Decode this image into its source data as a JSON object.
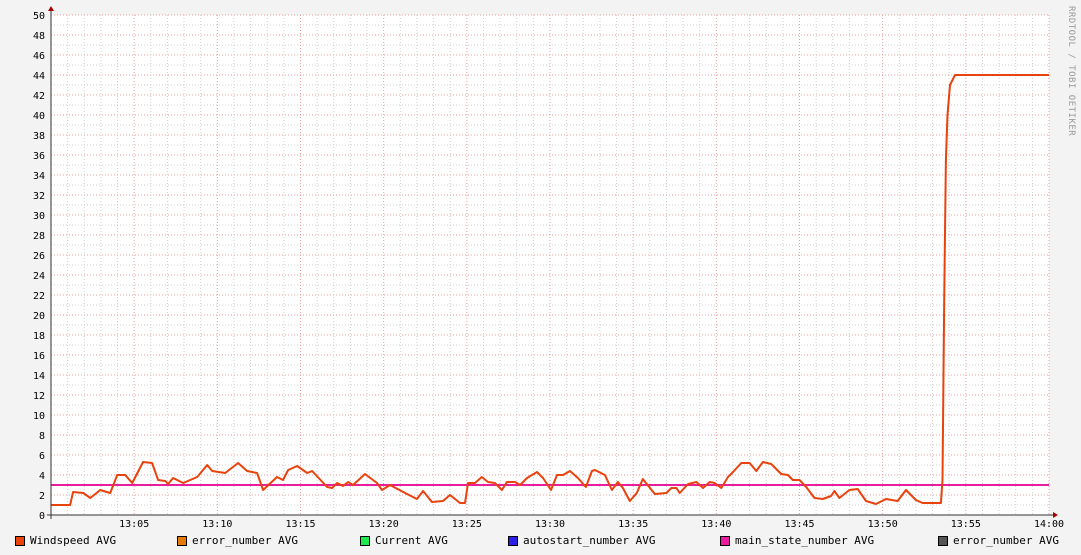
{
  "watermark": "RRDTOOL / TOBI OETIKER",
  "chart_data": {
    "type": "line",
    "title": "",
    "xlabel": "",
    "ylabel": "",
    "ylim": [
      0,
      50
    ],
    "xlim_minutes": [
      0,
      60
    ],
    "start_time": "13:00",
    "y_ticks": [
      "0",
      "2",
      "4",
      "6",
      "8",
      "10",
      "12",
      "14",
      "16",
      "18",
      "20",
      "22",
      "24",
      "26",
      "28",
      "30",
      "32",
      "34",
      "36",
      "38",
      "40",
      "42",
      "44",
      "46",
      "48",
      "50"
    ],
    "x_ticks": [
      "13:05",
      "13:10",
      "13:15",
      "13:20",
      "13:25",
      "13:30",
      "13:35",
      "13:40",
      "13:45",
      "13:50",
      "13:55",
      "14:00"
    ],
    "grid": true,
    "legend_position": "bottom",
    "legend": [
      {
        "label": "Windspeed AVG",
        "color": "#e8420d"
      },
      {
        "label": "error_number AVG",
        "color": "#e87a0d"
      },
      {
        "label": "Current AVG",
        "color": "#1ee84a"
      },
      {
        "label": "autostart_number AVG",
        "color": "#2a1ee8"
      },
      {
        "label": "main_state_number AVG",
        "color": "#e81e9f"
      },
      {
        "label": "error_number AVG",
        "color": "#555555"
      }
    ],
    "series": [
      {
        "name": "Windspeed AVG",
        "color": "#e8420d",
        "points": [
          [
            0,
            1.0
          ],
          [
            1.15,
            1.0
          ],
          [
            1.33,
            2.3
          ],
          [
            1.94,
            2.2
          ],
          [
            2.36,
            1.7
          ],
          [
            2.96,
            2.5
          ],
          [
            3.56,
            2.2
          ],
          [
            3.98,
            4.0
          ],
          [
            4.46,
            4.0
          ],
          [
            4.88,
            3.2
          ],
          [
            5.54,
            5.3
          ],
          [
            6.08,
            5.2
          ],
          [
            6.44,
            3.5
          ],
          [
            6.87,
            3.4
          ],
          [
            7.04,
            3.1
          ],
          [
            7.34,
            3.7
          ],
          [
            7.95,
            3.2
          ],
          [
            8.79,
            3.8
          ],
          [
            9.39,
            5.0
          ],
          [
            9.69,
            4.4
          ],
          [
            10.47,
            4.2
          ],
          [
            11.25,
            5.2
          ],
          [
            11.79,
            4.4
          ],
          [
            12.39,
            4.2
          ],
          [
            12.75,
            2.5
          ],
          [
            13.59,
            3.8
          ],
          [
            13.95,
            3.5
          ],
          [
            14.26,
            4.5
          ],
          [
            14.8,
            4.9
          ],
          [
            15.4,
            4.2
          ],
          [
            15.7,
            4.4
          ],
          [
            16.6,
            2.8
          ],
          [
            16.9,
            2.7
          ],
          [
            17.2,
            3.2
          ],
          [
            17.56,
            2.9
          ],
          [
            17.86,
            3.3
          ],
          [
            18.16,
            3.0
          ],
          [
            18.88,
            4.1
          ],
          [
            19.6,
            3.2
          ],
          [
            19.9,
            2.5
          ],
          [
            20.38,
            3.0
          ],
          [
            21.4,
            2.1
          ],
          [
            22.0,
            1.6
          ],
          [
            22.37,
            2.4
          ],
          [
            22.9,
            1.3
          ],
          [
            23.57,
            1.4
          ],
          [
            23.99,
            2.0
          ],
          [
            24.59,
            1.2
          ],
          [
            24.89,
            1.2
          ],
          [
            25.07,
            3.2
          ],
          [
            25.49,
            3.2
          ],
          [
            25.9,
            3.8
          ],
          [
            26.27,
            3.3
          ],
          [
            26.69,
            3.2
          ],
          [
            27.11,
            2.5
          ],
          [
            27.41,
            3.3
          ],
          [
            27.9,
            3.3
          ],
          [
            28.2,
            3.0
          ],
          [
            28.62,
            3.7
          ],
          [
            29.22,
            4.3
          ],
          [
            29.58,
            3.7
          ],
          [
            30.06,
            2.5
          ],
          [
            30.42,
            4.0
          ],
          [
            30.78,
            4.0
          ],
          [
            31.2,
            4.4
          ],
          [
            31.68,
            3.7
          ],
          [
            32.16,
            2.8
          ],
          [
            32.52,
            4.4
          ],
          [
            32.7,
            4.5
          ],
          [
            33.3,
            4.0
          ],
          [
            33.72,
            2.5
          ],
          [
            34.08,
            3.3
          ],
          [
            34.38,
            2.7
          ],
          [
            34.8,
            1.4
          ],
          [
            35.22,
            2.2
          ],
          [
            35.58,
            3.6
          ],
          [
            36.3,
            2.1
          ],
          [
            37.0,
            2.2
          ],
          [
            37.3,
            2.7
          ],
          [
            37.6,
            2.7
          ],
          [
            37.8,
            2.2
          ],
          [
            38.3,
            3.1
          ],
          [
            38.8,
            3.3
          ],
          [
            39.2,
            2.7
          ],
          [
            39.6,
            3.3
          ],
          [
            39.9,
            3.2
          ],
          [
            40.3,
            2.7
          ],
          [
            40.7,
            3.8
          ],
          [
            41.0,
            4.3
          ],
          [
            41.5,
            5.2
          ],
          [
            42.0,
            5.2
          ],
          [
            42.4,
            4.4
          ],
          [
            42.8,
            5.3
          ],
          [
            43.3,
            5.1
          ],
          [
            43.9,
            4.1
          ],
          [
            44.3,
            4.0
          ],
          [
            44.6,
            3.5
          ],
          [
            45.0,
            3.5
          ],
          [
            45.4,
            2.8
          ],
          [
            45.9,
            1.7
          ],
          [
            46.4,
            1.6
          ],
          [
            46.9,
            1.9
          ],
          [
            47.1,
            2.4
          ],
          [
            47.4,
            1.7
          ],
          [
            48.0,
            2.5
          ],
          [
            48.5,
            2.6
          ],
          [
            49.0,
            1.4
          ],
          [
            49.6,
            1.1
          ],
          [
            50.2,
            1.6
          ],
          [
            50.9,
            1.4
          ],
          [
            51.4,
            2.5
          ],
          [
            52.0,
            1.5
          ],
          [
            52.4,
            1.2
          ],
          [
            53.5,
            1.2
          ],
          [
            53.6,
            3.5
          ],
          [
            53.7,
            21.5
          ],
          [
            53.8,
            35.5
          ],
          [
            53.9,
            40.0
          ],
          [
            54.05,
            43.0
          ],
          [
            54.35,
            44.0
          ],
          [
            60,
            44.0
          ]
        ]
      },
      {
        "name": "main_state_number AVG",
        "color": "#e81e9f",
        "points": [
          [
            0,
            3
          ],
          [
            60,
            3
          ]
        ]
      }
    ]
  }
}
